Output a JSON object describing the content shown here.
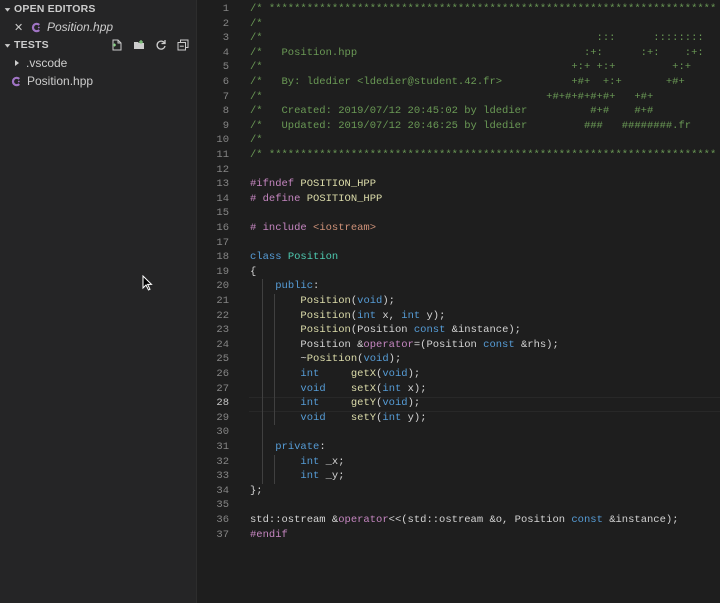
{
  "sidebar": {
    "open_editors_label": "OPEN EDITORS",
    "open_editors": [
      {
        "name": "Position.hpp",
        "close_glyph": "✕",
        "icon": "cpp-file-icon"
      }
    ],
    "folder_label": "TESTS",
    "tree": [
      {
        "name": ".vscode",
        "type": "folder"
      },
      {
        "name": "Position.hpp",
        "type": "file",
        "icon": "cpp-file-icon"
      }
    ],
    "toolbar_icons": [
      "new-file-icon",
      "new-folder-icon",
      "refresh-icon",
      "collapse-all-icon"
    ]
  },
  "editor": {
    "active_line": 28,
    "lines": [
      {
        "n": "1",
        "tokens": [
          [
            "c",
            "/* *********************************************************************** */"
          ]
        ]
      },
      {
        "n": "2",
        "tokens": [
          [
            "c",
            "/*                                                                         */"
          ]
        ]
      },
      {
        "n": "3",
        "tokens": [
          [
            "c",
            "/*                                                     :::      ::::::::   */"
          ]
        ]
      },
      {
        "n": "4",
        "tokens": [
          [
            "c",
            "/*   Position.hpp                                    :+:      :+:    :+:   */"
          ]
        ]
      },
      {
        "n": "5",
        "tokens": [
          [
            "c",
            "/*                                                 +:+ +:+         +:+     */"
          ]
        ]
      },
      {
        "n": "6",
        "tokens": [
          [
            "c",
            "/*   By: ldedier <ldedier@student.42.fr>           +#+  +:+       +#+        */"
          ]
        ]
      },
      {
        "n": "7",
        "tokens": [
          [
            "c",
            "/*                                             +#+#+#+#+#+   +#+           */"
          ]
        ]
      },
      {
        "n": "8",
        "tokens": [
          [
            "c",
            "/*   Created: 2019/07/12 20:45:02 by ldedier          #+#    #+#             */"
          ]
        ]
      },
      {
        "n": "9",
        "tokens": [
          [
            "c",
            "/*   Updated: 2019/07/12 20:46:25 by ldedier         ###   ########.fr       */"
          ]
        ]
      },
      {
        "n": "10",
        "tokens": [
          [
            "c",
            "/*                                                                         */"
          ]
        ]
      },
      {
        "n": "11",
        "tokens": [
          [
            "c",
            "/* *********************************************************************** */"
          ]
        ]
      },
      {
        "n": "12",
        "tokens": []
      },
      {
        "n": "13",
        "tokens": [
          [
            "p",
            "#ifndef "
          ],
          [
            "m",
            "POSITION_HPP"
          ]
        ]
      },
      {
        "n": "14",
        "tokens": [
          [
            "p",
            "# define "
          ],
          [
            "m",
            "POSITION_HPP"
          ]
        ]
      },
      {
        "n": "15",
        "tokens": []
      },
      {
        "n": "16",
        "tokens": [
          [
            "p",
            "# include "
          ],
          [
            "s",
            "<iostream>"
          ]
        ]
      },
      {
        "n": "17",
        "tokens": []
      },
      {
        "n": "18",
        "tokens": [
          [
            "k",
            "class "
          ],
          [
            "t",
            "Position"
          ]
        ]
      },
      {
        "n": "19",
        "tokens": [
          [
            "x",
            "{"
          ]
        ]
      },
      {
        "n": "20",
        "tokens": [
          [
            "x",
            "    "
          ],
          [
            "k",
            "public"
          ],
          [
            "x",
            ":"
          ]
        ]
      },
      {
        "n": "21",
        "tokens": [
          [
            "x",
            "        "
          ],
          [
            "f",
            "Position"
          ],
          [
            "x",
            "("
          ],
          [
            "k",
            "void"
          ],
          [
            "x",
            ");"
          ]
        ]
      },
      {
        "n": "22",
        "tokens": [
          [
            "x",
            "        "
          ],
          [
            "f",
            "Position"
          ],
          [
            "x",
            "("
          ],
          [
            "k",
            "int"
          ],
          [
            "x",
            " x, "
          ],
          [
            "k",
            "int"
          ],
          [
            "x",
            " y);"
          ]
        ]
      },
      {
        "n": "23",
        "tokens": [
          [
            "x",
            "        "
          ],
          [
            "f",
            "Position"
          ],
          [
            "x",
            "(Position "
          ],
          [
            "k",
            "const"
          ],
          [
            "x",
            " &instance);"
          ]
        ]
      },
      {
        "n": "24",
        "tokens": [
          [
            "x",
            "        Position &"
          ],
          [
            "o",
            "operator"
          ],
          [
            "x",
            "=(Position "
          ],
          [
            "k",
            "const"
          ],
          [
            "x",
            " &rhs);"
          ]
        ]
      },
      {
        "n": "25",
        "tokens": [
          [
            "x",
            "        ~"
          ],
          [
            "f",
            "Position"
          ],
          [
            "x",
            "("
          ],
          [
            "k",
            "void"
          ],
          [
            "x",
            ");"
          ]
        ]
      },
      {
        "n": "26",
        "tokens": [
          [
            "x",
            "        "
          ],
          [
            "k",
            "int"
          ],
          [
            "x",
            "     "
          ],
          [
            "f",
            "getX"
          ],
          [
            "x",
            "("
          ],
          [
            "k",
            "void"
          ],
          [
            "x",
            ");"
          ]
        ]
      },
      {
        "n": "27",
        "tokens": [
          [
            "x",
            "        "
          ],
          [
            "k",
            "void"
          ],
          [
            "x",
            "    "
          ],
          [
            "f",
            "setX"
          ],
          [
            "x",
            "("
          ],
          [
            "k",
            "int"
          ],
          [
            "x",
            " x);"
          ]
        ]
      },
      {
        "n": "28",
        "tokens": [
          [
            "x",
            "        "
          ],
          [
            "k",
            "int"
          ],
          [
            "x",
            "     "
          ],
          [
            "f",
            "getY"
          ],
          [
            "x",
            "("
          ],
          [
            "k",
            "void"
          ],
          [
            "x",
            ");"
          ]
        ]
      },
      {
        "n": "29",
        "tokens": [
          [
            "x",
            "        "
          ],
          [
            "k",
            "void"
          ],
          [
            "x",
            "    "
          ],
          [
            "f",
            "setY"
          ],
          [
            "x",
            "("
          ],
          [
            "k",
            "int"
          ],
          [
            "x",
            " y);"
          ]
        ]
      },
      {
        "n": "30",
        "tokens": []
      },
      {
        "n": "31",
        "tokens": [
          [
            "x",
            "    "
          ],
          [
            "k",
            "private"
          ],
          [
            "x",
            ":"
          ]
        ]
      },
      {
        "n": "32",
        "tokens": [
          [
            "x",
            "        "
          ],
          [
            "k",
            "int"
          ],
          [
            "x",
            " _x;"
          ]
        ]
      },
      {
        "n": "33",
        "tokens": [
          [
            "x",
            "        "
          ],
          [
            "k",
            "int"
          ],
          [
            "x",
            " _y;"
          ]
        ]
      },
      {
        "n": "34",
        "tokens": [
          [
            "x",
            "};"
          ]
        ]
      },
      {
        "n": "35",
        "tokens": []
      },
      {
        "n": "36",
        "tokens": [
          [
            "x",
            "std::ostream &"
          ],
          [
            "o",
            "operator"
          ],
          [
            "x",
            "<<(std::ostream &o, Position "
          ],
          [
            "k",
            "const"
          ],
          [
            "x",
            " &instance);"
          ]
        ]
      },
      {
        "n": "37",
        "tokens": [
          [
            "p",
            "#endif"
          ]
        ]
      }
    ]
  },
  "colors": {
    "comment": "#6a9955",
    "preprocessor": "#c586c0",
    "keyword": "#569cd6",
    "type": "#4ec9b0",
    "function": "#dcdcaa",
    "string": "#ce9178",
    "text": "#d4d4d4",
    "line_number": "#858585",
    "cpp_icon": "#a074c4"
  }
}
